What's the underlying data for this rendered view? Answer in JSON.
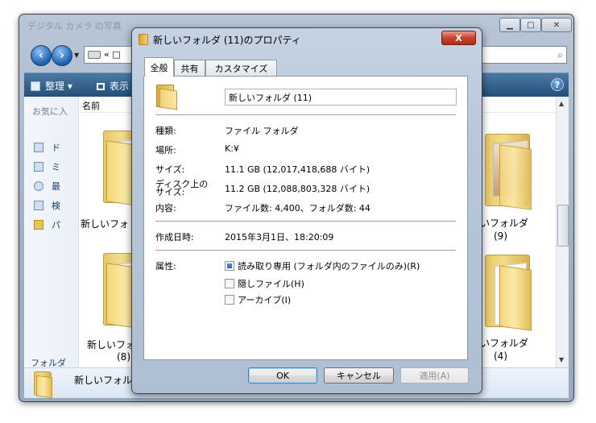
{
  "explorer": {
    "title": "デジタル カメラ の写真",
    "address_text": "«  □",
    "toolbar": {
      "organize": "整理 ▾",
      "views": "表示"
    },
    "nav": {
      "header": "お気に入",
      "items": [
        "ド",
        "ミ",
        "最",
        "検",
        "パ"
      ],
      "folders_label": "フォルダ"
    },
    "column_name": "名前",
    "items": [
      {
        "label_line1": "新しいフォ",
        "label_line2": ""
      },
      {
        "label_line1": "新しいフォ",
        "label_line2": "(8)"
      },
      {
        "label_line1": "いフォルダ",
        "label_line2": "(9)"
      },
      {
        "label_line1": "いフォルダ",
        "label_line2": "(4)"
      }
    ],
    "details_name": "新しいフォル"
  },
  "dialog": {
    "title": "新しいフォルダ (11)のプロパティ",
    "close_glyph": "X",
    "tabs": [
      "全般",
      "共有",
      "カスタマイズ"
    ],
    "folder_name": "新しいフォルダ (11)",
    "rows": {
      "type_label": "種類:",
      "type_value": "ファイル フォルダ",
      "location_label": "場所:",
      "location_value": "K:¥",
      "size_label": "サイズ:",
      "size_value": "11.1 GB (12,017,418,688 バイト)",
      "disk_size_label": "ディスク上のサイズ:",
      "disk_size_value": "11.2 GB (12,088,803,328 バイト)",
      "contents_label": "内容:",
      "contents_value": "ファイル数: 4,400、フォルダ数: 44",
      "created_label": "作成日時:",
      "created_value": "2015年3月1日、18:20:09",
      "attributes_label": "属性:"
    },
    "attributes": {
      "readonly": "読み取り専用 (フォルダ内のファイルのみ)(R)",
      "hidden": "隠しファイル(H)",
      "archive": "アーカイブ(I)"
    },
    "buttons": {
      "ok": "OK",
      "cancel": "キャンセル",
      "apply": "適用(A)"
    }
  },
  "colors": {
    "accent": "#2d5fa8",
    "toolbar": "#2f5a84",
    "close_red": "#c8432c"
  }
}
